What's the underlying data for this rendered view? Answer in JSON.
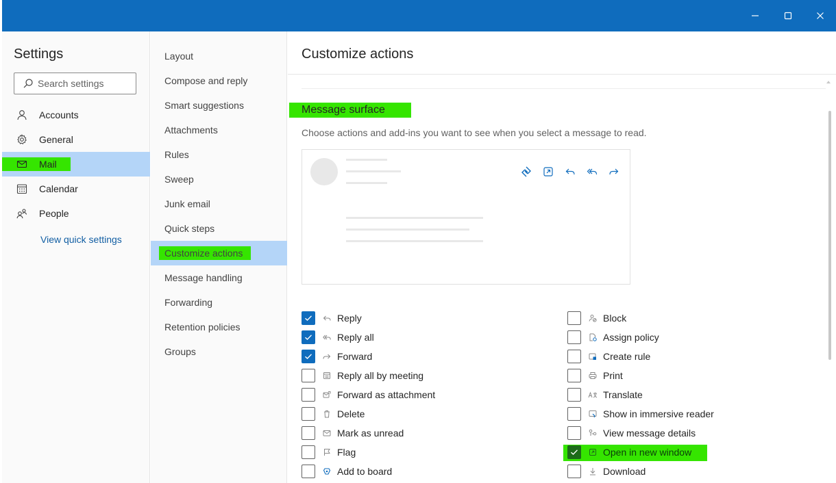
{
  "window": {
    "minimize_label": "minimize",
    "maximize_label": "maximize",
    "close_label": "close"
  },
  "settings": {
    "title": "Settings",
    "search_placeholder": "Search settings",
    "items": [
      {
        "label": "Accounts",
        "icon": "person-icon"
      },
      {
        "label": "General",
        "icon": "gear-icon"
      },
      {
        "label": "Mail",
        "icon": "mail-icon"
      },
      {
        "label": "Calendar",
        "icon": "calendar-icon"
      },
      {
        "label": "People",
        "icon": "people-icon"
      }
    ],
    "quick_settings_link": "View quick settings"
  },
  "mail_settings": {
    "items": [
      "Layout",
      "Compose and reply",
      "Smart suggestions",
      "Attachments",
      "Rules",
      "Sweep",
      "Junk email",
      "Quick steps",
      "Customize actions",
      "Message handling",
      "Forwarding",
      "Retention policies",
      "Groups"
    ],
    "selected": "Customize actions"
  },
  "content": {
    "title": "Customize actions",
    "section_title": "Message surface",
    "section_desc": "Choose actions and add-ins you want to see when you select a message to read.",
    "preview_icons": [
      "loop-icon",
      "open-window-icon",
      "reply-icon",
      "reply-all-icon",
      "forward-icon"
    ],
    "left_options": [
      {
        "label": "Reply",
        "checked": true,
        "icon": "reply-icon"
      },
      {
        "label": "Reply all",
        "checked": true,
        "icon": "reply-all-icon"
      },
      {
        "label": "Forward",
        "checked": true,
        "icon": "forward-icon"
      },
      {
        "label": "Reply all by meeting",
        "checked": false,
        "icon": "meeting-icon"
      },
      {
        "label": "Forward as attachment",
        "checked": false,
        "icon": "forward-attachment-icon"
      },
      {
        "label": "Delete",
        "checked": false,
        "icon": "trash-icon"
      },
      {
        "label": "Mark as unread",
        "checked": false,
        "icon": "envelope-icon"
      },
      {
        "label": "Flag",
        "checked": false,
        "icon": "flag-icon"
      },
      {
        "label": "Add to board",
        "checked": false,
        "icon": "board-icon"
      }
    ],
    "right_options": [
      {
        "label": "Block",
        "checked": false,
        "icon": "block-icon"
      },
      {
        "label": "Assign policy",
        "checked": false,
        "icon": "policy-icon"
      },
      {
        "label": "Create rule",
        "checked": false,
        "icon": "rule-icon"
      },
      {
        "label": "Print",
        "checked": false,
        "icon": "print-icon"
      },
      {
        "label": "Translate",
        "checked": false,
        "icon": "translate-icon"
      },
      {
        "label": "Show in immersive reader",
        "checked": false,
        "icon": "immersive-reader-icon"
      },
      {
        "label": "View message details",
        "checked": false,
        "icon": "details-icon"
      },
      {
        "label": "Open in new window",
        "checked": true,
        "icon": "open-window-icon"
      },
      {
        "label": "Download",
        "checked": false,
        "icon": "download-icon"
      }
    ]
  },
  "colors": {
    "titlebar": "#0f6cbd",
    "selected_bg": "#b4d5f8",
    "highlight": "#35e500",
    "checkbox_checked": "#0f6cbd"
  }
}
